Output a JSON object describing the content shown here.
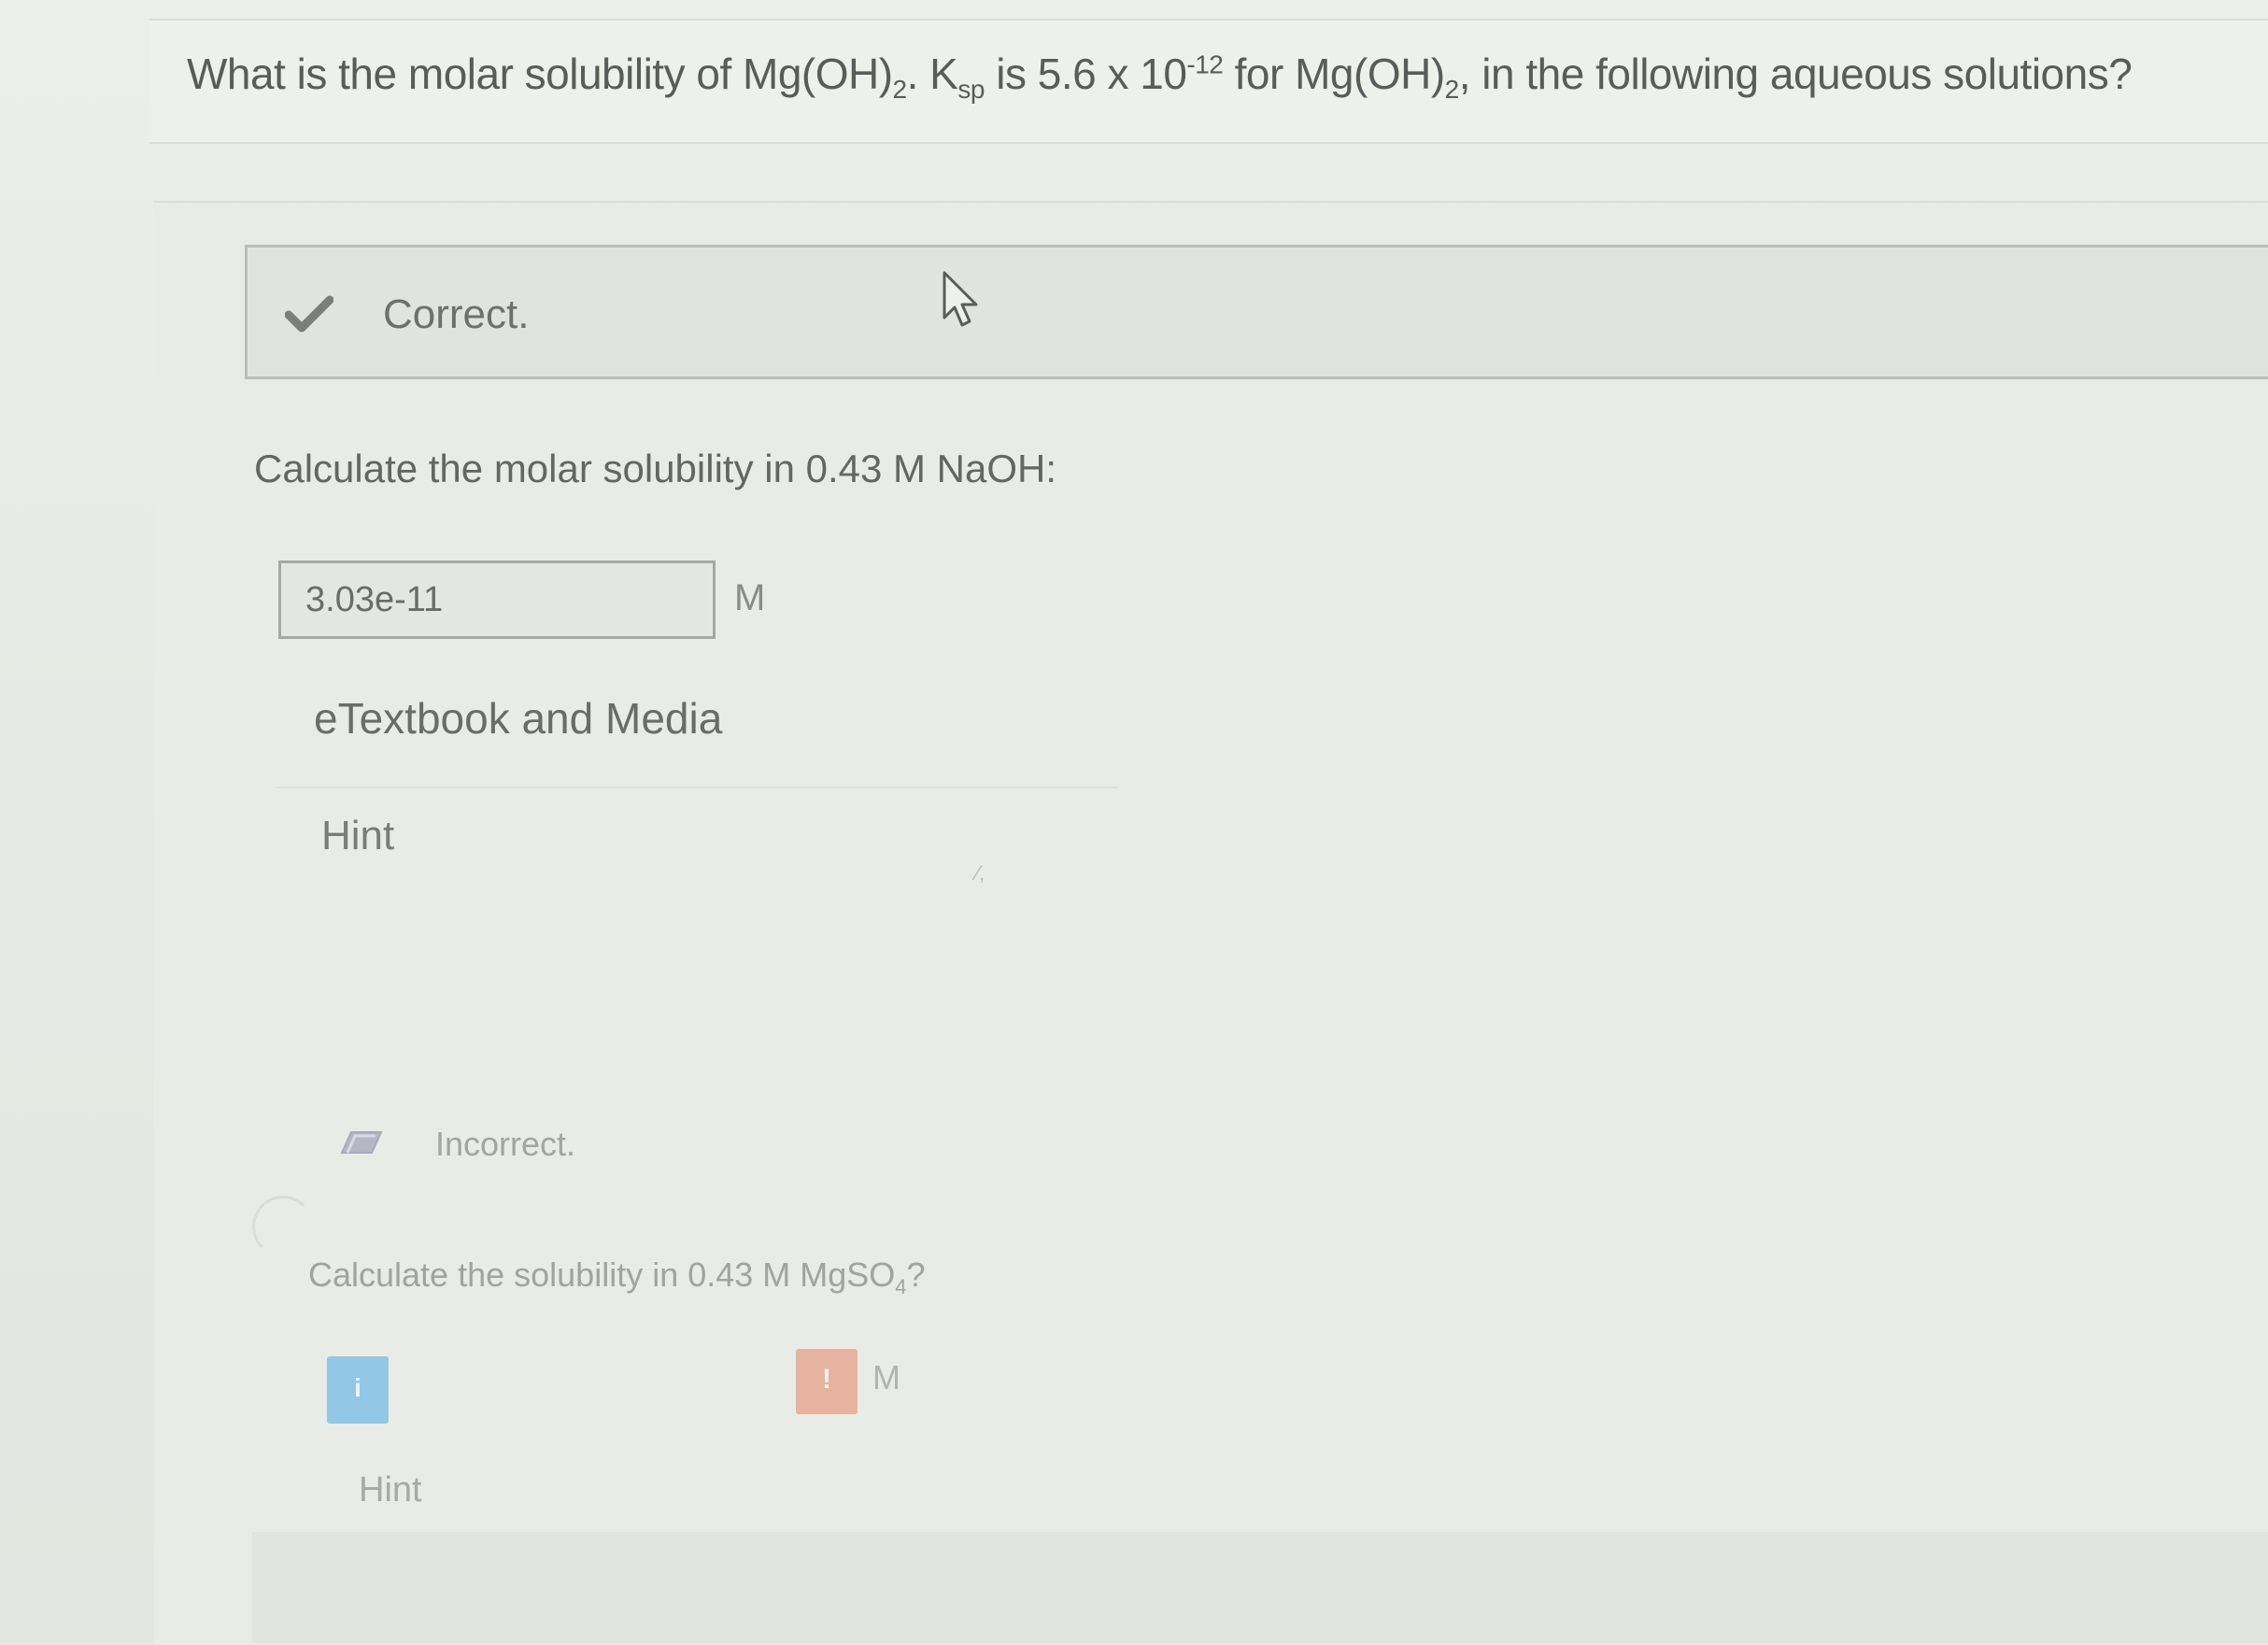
{
  "question": {
    "prefix": "What is the molar solubility of Mg(OH)",
    "sub1": "2",
    "ksp_k": ". K",
    "ksp_sub": "sp",
    "middle": " is 5.6 x 10",
    "exponent": "-12",
    "after_exp": " for Mg(OH)",
    "sub2": "2",
    "suffix": ", in the following aqueous solutions?"
  },
  "part1": {
    "status_label": "Correct.",
    "prompt": "Calculate the molar solubility in 0.43 M NaOH:",
    "answer_value": "3.03e-11",
    "unit": "M",
    "etextbook_label": "eTextbook and Media",
    "hint_label": "Hint"
  },
  "part2": {
    "status_label": "Incorrect.",
    "prompt_prefix": "Calculate the solubility in 0.43 M MgSO",
    "prompt_sub": "4",
    "prompt_suffix": "?",
    "info_badge": "i",
    "error_badge": "!",
    "unit": "M",
    "hint_label": "Hint"
  },
  "colors": {
    "correct_check": "#7b7e79",
    "info_badge": "#92c8e6",
    "error_badge": "#e5b3a0"
  },
  "icons": {
    "correct": "check-icon",
    "incorrect": "pencil-icon",
    "cursor": "mouse-pointer-icon"
  }
}
